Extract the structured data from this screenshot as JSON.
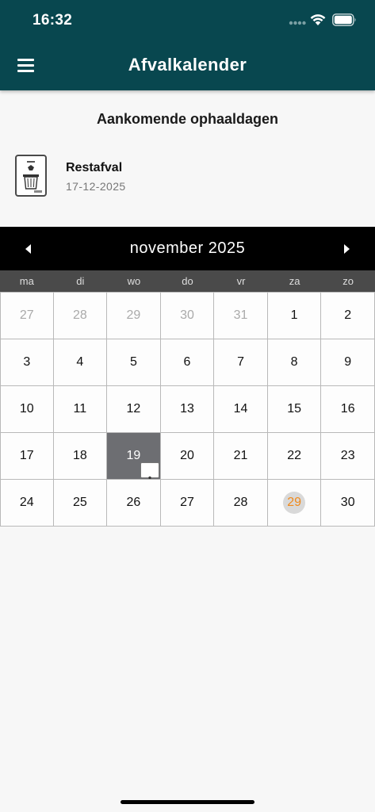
{
  "status_bar": {
    "time": "16:32"
  },
  "header": {
    "title": "Afvalkalender",
    "menu_icon": "hamburger-menu-icon"
  },
  "upcoming": {
    "title": "Aankomende ophaaldagen",
    "items": [
      {
        "type": "Restafval",
        "date": "17-12-2025",
        "icon": "restafval-bin-icon"
      }
    ]
  },
  "calendar": {
    "month_label": "november 2025",
    "weekdays": [
      "ma",
      "di",
      "wo",
      "do",
      "vr",
      "za",
      "zo"
    ],
    "days": [
      {
        "d": "27",
        "muted": true
      },
      {
        "d": "28",
        "muted": true
      },
      {
        "d": "29",
        "muted": true
      },
      {
        "d": "30",
        "muted": true
      },
      {
        "d": "31",
        "muted": true
      },
      {
        "d": "1"
      },
      {
        "d": "2"
      },
      {
        "d": "3"
      },
      {
        "d": "4"
      },
      {
        "d": "5"
      },
      {
        "d": "6"
      },
      {
        "d": "7"
      },
      {
        "d": "8"
      },
      {
        "d": "9"
      },
      {
        "d": "10"
      },
      {
        "d": "11"
      },
      {
        "d": "12"
      },
      {
        "d": "13"
      },
      {
        "d": "14"
      },
      {
        "d": "15"
      },
      {
        "d": "16"
      },
      {
        "d": "17"
      },
      {
        "d": "18"
      },
      {
        "d": "19",
        "pickup": true
      },
      {
        "d": "20"
      },
      {
        "d": "21"
      },
      {
        "d": "22"
      },
      {
        "d": "23"
      },
      {
        "d": "24"
      },
      {
        "d": "25"
      },
      {
        "d": "26"
      },
      {
        "d": "27"
      },
      {
        "d": "28"
      },
      {
        "d": "29",
        "today": true
      },
      {
        "d": "30"
      }
    ]
  },
  "colors": {
    "header_bg": "#08474f",
    "today_text": "#f08a1c",
    "pickup_bg": "#6d6e72"
  }
}
